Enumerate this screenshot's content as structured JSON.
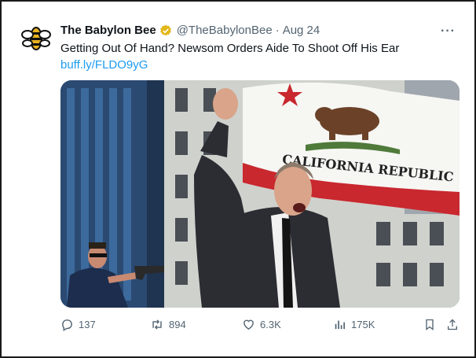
{
  "tweet": {
    "author_name": "The Babylon Bee",
    "handle": "@TheBabylonBee",
    "separator": "·",
    "time": "Aug 24",
    "more_label": "···",
    "text": "Getting Out Of Hand? Newsom Orders Aide To Shoot Off His Ear",
    "link": "buff.ly/FLDO9yG"
  },
  "media": {
    "flag_text": "CALIFORNIA REPUBLIC"
  },
  "actions": {
    "replies": "137",
    "retweets": "894",
    "likes": "6.3K",
    "views": "175K"
  },
  "colors": {
    "accent": "#1d9bf0",
    "text": "#0f1419",
    "muted": "#536471",
    "verified_gold": "#e2b719",
    "flag_red": "#c8282e"
  },
  "icons": [
    "babylon-bee-logo",
    "verified-badge-icon",
    "more-icon",
    "reply-icon",
    "retweet-icon",
    "like-icon",
    "views-icon",
    "bookmark-icon",
    "share-icon"
  ]
}
